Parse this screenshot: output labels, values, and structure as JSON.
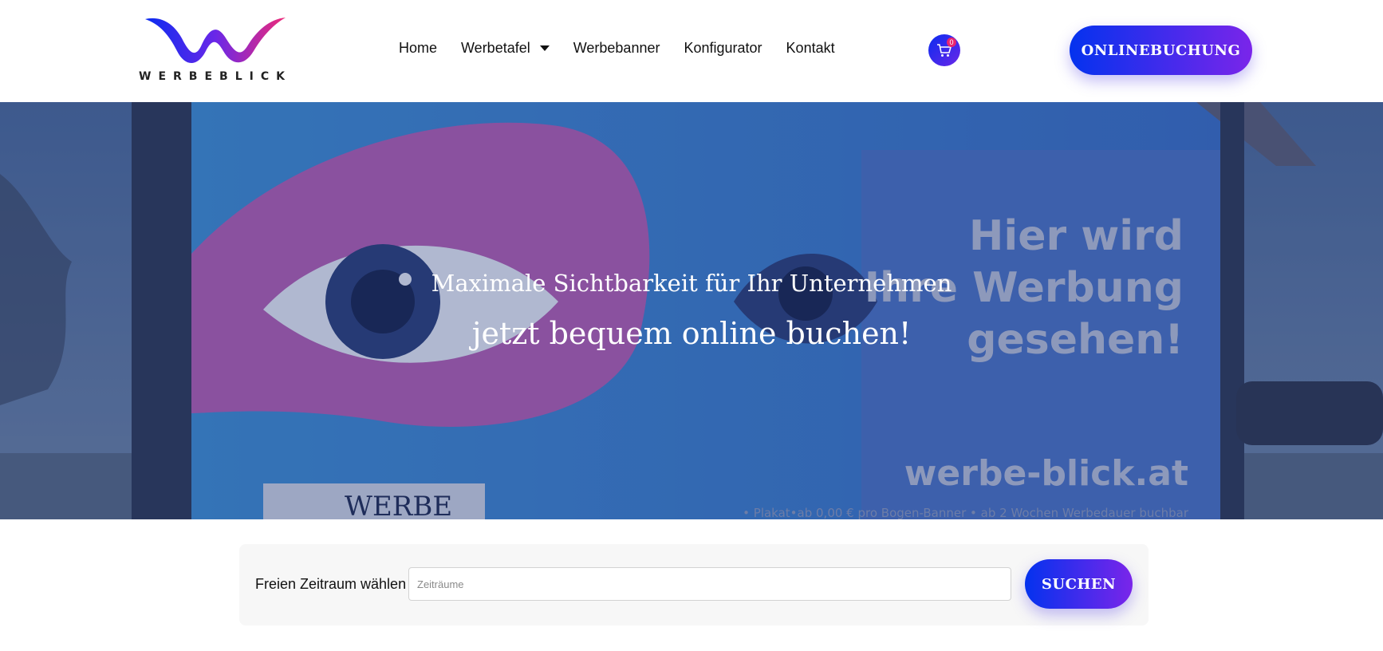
{
  "brand": {
    "logo_text": "WERBEBLICK",
    "colors": {
      "accent_start": "#0432ee",
      "accent_end": "#7a25ea",
      "pink": "#e8246f"
    }
  },
  "nav": {
    "items": [
      {
        "label": "Home"
      },
      {
        "label": "Werbetafel",
        "has_dropdown": true
      },
      {
        "label": "Werbebanner"
      },
      {
        "label": "Konfigurator"
      },
      {
        "label": "Kontakt"
      }
    ],
    "cart": {
      "icon": "cart-icon",
      "count": "0"
    },
    "cta_label": "ONLINEBUCHUNG"
  },
  "hero": {
    "subtitle": "Maximale Sichtbarkeit für Ihr Unternehmen",
    "title": "jetzt bequem online buchen!",
    "billboard_text": {
      "line1": "Hier wird",
      "line2": "Ihre Werbung",
      "line3": "gesehen!",
      "url": "werbe-blick.at",
      "footer": "• Plakat•ab 0,00 € pro Bogen-Banner • ab 2 Wochen Werbedauer buchbar",
      "sign": "WERBE"
    }
  },
  "search": {
    "label": "Freien Zeitraum wählen",
    "placeholder": "Zeiträume",
    "value": "",
    "button_label": "SUCHEN"
  }
}
